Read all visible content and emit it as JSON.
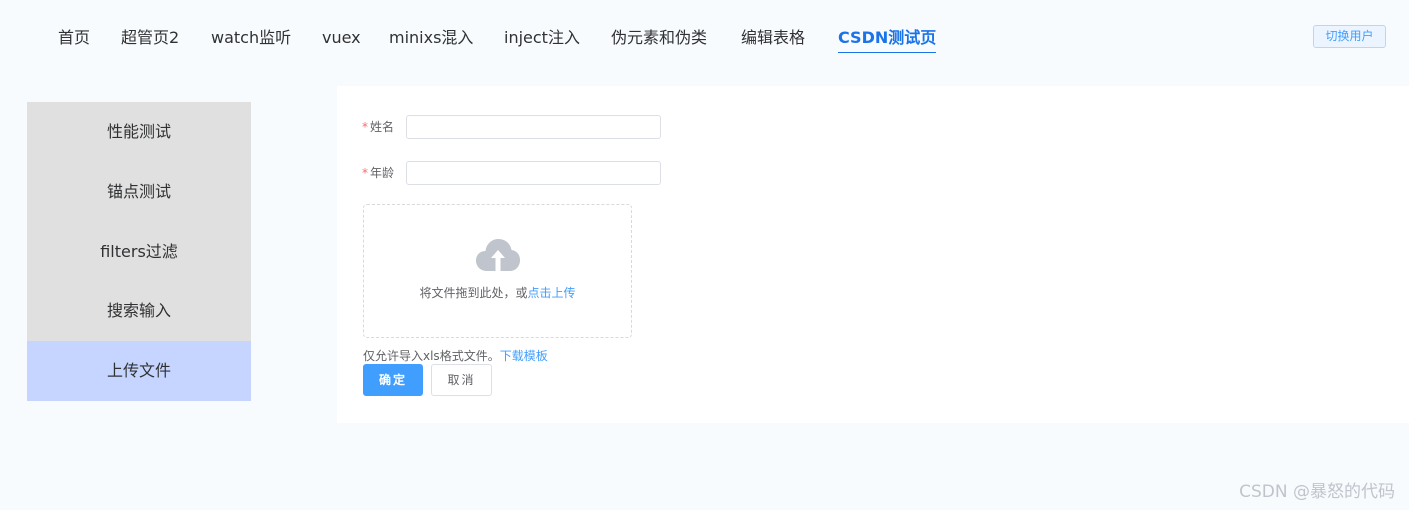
{
  "nav": {
    "items": [
      {
        "label": "首页"
      },
      {
        "label": "超管页2"
      },
      {
        "label": "watch监听"
      },
      {
        "label": "vuex"
      },
      {
        "label": "minixs混入"
      },
      {
        "label": "inject注入"
      },
      {
        "label": "伪元素和伪类"
      },
      {
        "label": "编辑表格"
      },
      {
        "label": "CSDN测试页"
      }
    ],
    "active_index": 8,
    "switch_user": "切换用户",
    "accent_color": "#1a73e8"
  },
  "sidebar": {
    "items": [
      {
        "label": "性能测试"
      },
      {
        "label": "锚点测试"
      },
      {
        "label": "filters过滤"
      },
      {
        "label": "搜索输入"
      },
      {
        "label": "上传文件"
      }
    ],
    "active_index": 4,
    "active_color": "#c6d5ff",
    "bg_color": "#e0e0e0"
  },
  "form": {
    "required_mark": "*",
    "name_label": "姓名",
    "name_value": "",
    "age_label": "年龄",
    "age_value": ""
  },
  "upload": {
    "icon": "upload-cloud-icon",
    "text": "将文件拖到此处，或",
    "link": "点击上传",
    "tip": "仅允许导入xls格式文件。",
    "tip_link": "下载模板"
  },
  "buttons": {
    "confirm": "确定",
    "cancel": "取消",
    "primary_color": "#409eff"
  },
  "watermark": "CSDN @暴怒的代码"
}
